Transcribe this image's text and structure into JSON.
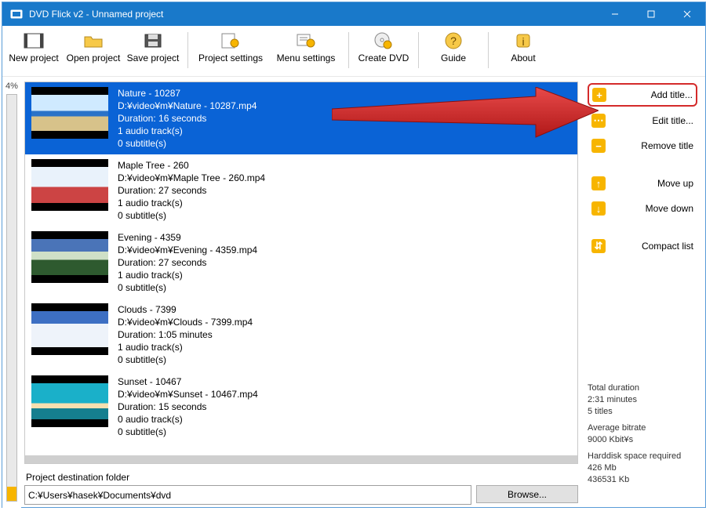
{
  "window": {
    "title": "DVD Flick v2 - Unnamed project"
  },
  "toolbar": {
    "new": "New project",
    "open": "Open project",
    "save": "Save project",
    "psettings": "Project settings",
    "msettings": "Menu settings",
    "create": "Create DVD",
    "guide": "Guide",
    "about": "About"
  },
  "usage": {
    "percent": "4%"
  },
  "titles": [
    {
      "ename": "Nature - 10287",
      "path": "D:¥video¥m¥Nature - 10287.mp4",
      "duration": "Duration: 16 seconds",
      "audio": "1 audio track(s)",
      "subs": "0 subtitle(s)",
      "selected": true,
      "pic": "pic-nature"
    },
    {
      "ename": "Maple Tree - 260",
      "path": "D:¥video¥m¥Maple Tree - 260.mp4",
      "duration": "Duration: 27 seconds",
      "audio": "1 audio track(s)",
      "subs": "0 subtitle(s)",
      "selected": false,
      "pic": "pic-maple"
    },
    {
      "ename": "Evening - 4359",
      "path": "D:¥video¥m¥Evening - 4359.mp4",
      "duration": "Duration: 27 seconds",
      "audio": "1 audio track(s)",
      "subs": "0 subtitle(s)",
      "selected": false,
      "pic": "pic-evening"
    },
    {
      "ename": "Clouds - 7399",
      "path": "D:¥video¥m¥Clouds - 7399.mp4",
      "duration": "Duration: 1:05 minutes",
      "audio": "1 audio track(s)",
      "subs": "0 subtitle(s)",
      "selected": false,
      "pic": "pic-clouds"
    },
    {
      "ename": "Sunset - 10467",
      "path": "D:¥video¥m¥Sunset - 10467.mp4",
      "duration": "Duration: 15 seconds",
      "audio": "0 audio track(s)",
      "subs": "0 subtitle(s)",
      "selected": false,
      "pic": "pic-sunset"
    }
  ],
  "actions": {
    "add": "Add title...",
    "edit": "Edit title...",
    "remove": "Remove title",
    "moveup": "Move up",
    "movedown": "Move down",
    "compact": "Compact list"
  },
  "stats": {
    "duration_k": "Total duration",
    "duration_v": "2:31 minutes",
    "count": "5 titles",
    "bitrate_k": "Average bitrate",
    "bitrate_v": "9000 Kbit¥s",
    "hdd_k": "Harddisk space required",
    "hdd_v1": "426 Mb",
    "hdd_v2": "436531 Kb"
  },
  "dest": {
    "label": "Project destination folder",
    "value": "C:¥Users¥hasek¥Documents¥dvd",
    "browse": "Browse..."
  }
}
